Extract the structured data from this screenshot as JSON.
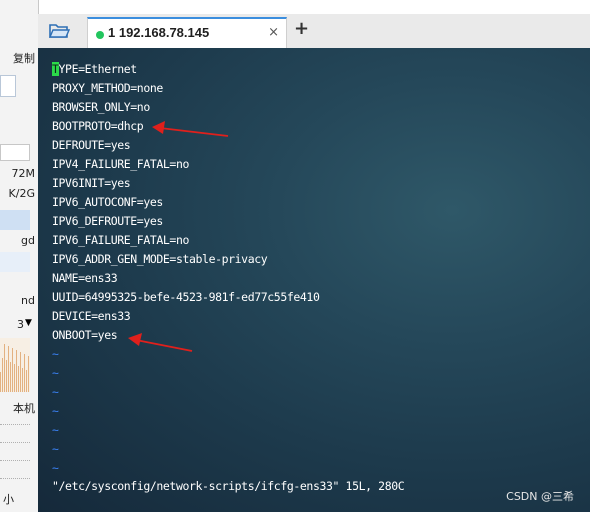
{
  "sidebar": {
    "copy_label": "复制",
    "size1": "72M",
    "size2": "K/2G",
    "item1": "gd",
    "item2": "nd",
    "dropdown_value": "3",
    "local_label": "本机",
    "small_label": "小"
  },
  "tabs": [
    {
      "label": "1 192.168.78.145",
      "status": "connected"
    }
  ],
  "tab_close_glyph": "×",
  "new_tab_glyph": "+",
  "terminal": {
    "first_char": "T",
    "first_rest": "YPE=Ethernet",
    "lines": [
      "PROXY_METHOD=none",
      "BROWSER_ONLY=no",
      "BOOTPROTO=dhcp",
      "DEFROUTE=yes",
      "IPV4_FAILURE_FATAL=no",
      "IPV6INIT=yes",
      "IPV6_AUTOCONF=yes",
      "IPV6_DEFROUTE=yes",
      "IPV6_FAILURE_FATAL=no",
      "IPV6_ADDR_GEN_MODE=stable-privacy",
      "NAME=ens33",
      "UUID=64995325-befe-4523-981f-ed77c55fe410",
      "DEVICE=ens33",
      "ONBOOT=yes"
    ],
    "tilde": "~",
    "status_line": "\"/etc/sysconfig/network-scripts/ifcfg-ens33\" 15L, 280C"
  },
  "watermark": "CSDN @三希",
  "colors": {
    "arrow": "#e0201c",
    "tilde": "#3b82f6",
    "cursor": "#2bd94a",
    "tab_accent": "#3b8ede",
    "status_dot": "#22c55e"
  },
  "icons": [
    "folder-icon",
    "close-icon",
    "plus-icon",
    "arrow-icon",
    "dropdown-arrow-icon"
  ]
}
